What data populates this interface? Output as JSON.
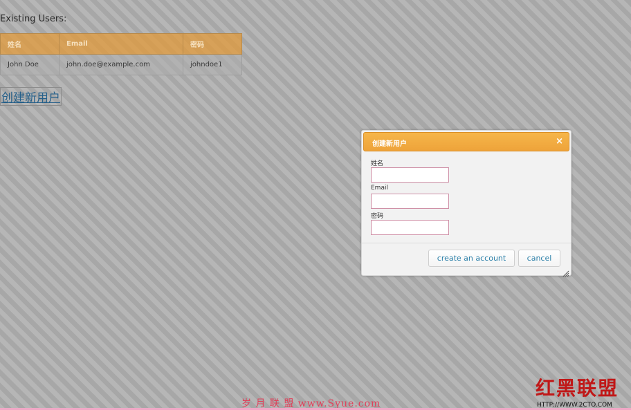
{
  "page": {
    "users_heading": "Existing Users:",
    "create_link": "创建新用户"
  },
  "users_table": {
    "headers": [
      "姓名",
      "Email",
      "密码"
    ],
    "rows": [
      [
        "John Doe",
        "john.doe@example.com",
        "johndoe1"
      ]
    ]
  },
  "dialog": {
    "title": "创建新用户",
    "close_glyph": "×",
    "fields": [
      {
        "label": "姓名",
        "value": ""
      },
      {
        "label": "Email",
        "value": ""
      },
      {
        "label": "密码",
        "value": ""
      }
    ],
    "create_button": "create an account",
    "cancel_button": "cancel"
  },
  "watermarks": {
    "left_text": "岁 月 联 盟  www.Syue.com",
    "right_logo": "红黑联盟",
    "right_url": "HTTP://WWW.2CTO.COM"
  },
  "colors": {
    "table_header": "#e29a3a",
    "dialog_title": "#f6b64a",
    "button_text": "#2a7fa8",
    "link": "#26608a"
  }
}
